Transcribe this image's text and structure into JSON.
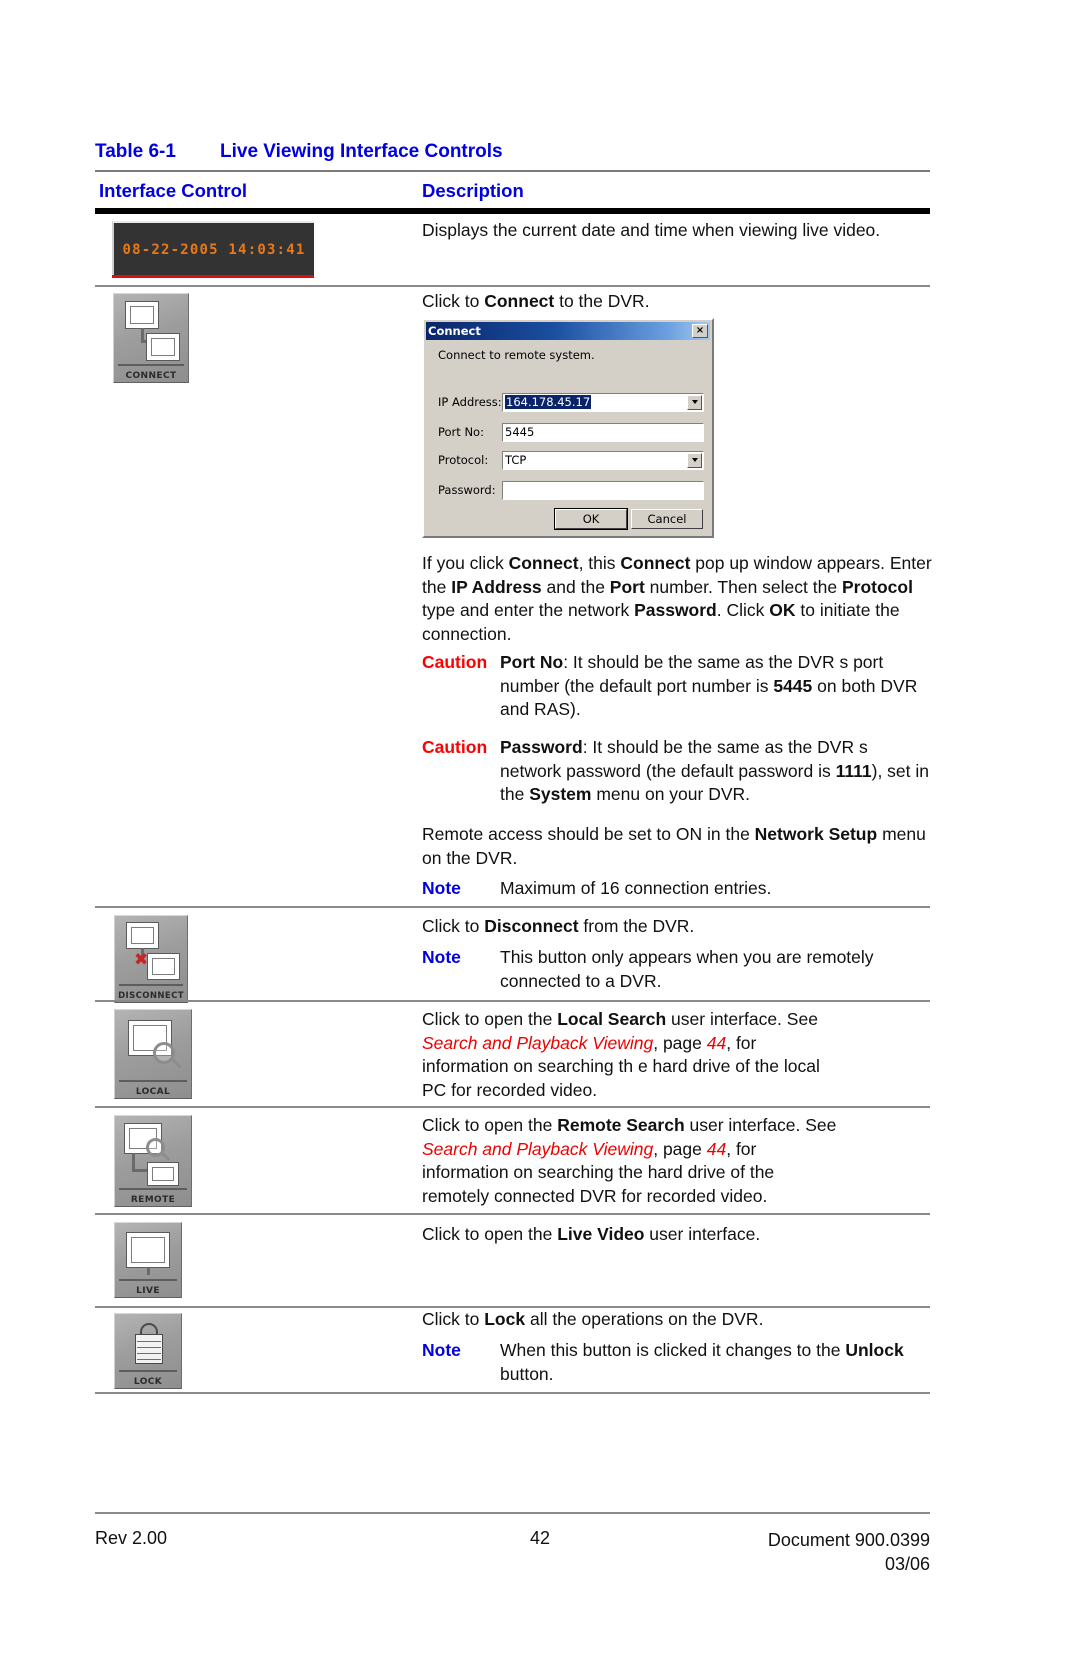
{
  "table": {
    "caption_label": "Table 6-1",
    "caption_title": "Live Viewing Interface Controls",
    "header_control": "Interface Control",
    "header_description": "Description"
  },
  "rows": {
    "datetime": {
      "display_value": "08-22-2005 14:03:41",
      "description": "Displays the current date and time when viewing live video."
    },
    "connect": {
      "icon_caption": "CONNECT",
      "lead_text_pre": "Click to ",
      "lead_text_bold": "Connect",
      "lead_text_post": " to the DVR.",
      "para1": "If you click Connect, this Connect pop up window appears. Enter the IP Address and the Port number. Then select the Protocol type and enter the network Password. Click OK to initiate the connection.",
      "caution1_label": "Caution",
      "caution1_text": "Port No: It should be the same as the DVR s port number (the default port number is  5445 on both DVR and RAS).",
      "caution2_label": "Caution",
      "caution2_text": "Password: It should be the same as the DVR s network password (the default password is 1111), set in the System menu on your DVR.",
      "para2": "Remote access should be set to ON in the Network Setup menu on the DVR.",
      "note_label": "Note",
      "note_text": "Maximum of 16 connection entries."
    },
    "disconnect": {
      "icon_caption": "DISCONNECT",
      "lead_pre": "Click to ",
      "lead_bold": "Disconnect",
      "lead_post": " from the DVR.",
      "note_label": "Note",
      "note_text": "This button only appears when you are remotely connected to a DVR."
    },
    "local": {
      "icon_caption": "LOCAL",
      "line1_pre": "Click to open the ",
      "line1_bold": "Local Search",
      "line1_post": " user interface. See",
      "ref_italic": "Search and Playback Viewing",
      "ref_mid": ", page ",
      "ref_page": "44",
      "ref_post": ", for",
      "line3": "information on searching th e hard drive of the local",
      "line4": "PC for recorded video."
    },
    "remote": {
      "icon_caption": "REMOTE",
      "line1_pre": "Click to open the ",
      "line1_bold": "Remote Search",
      "line1_post": " user interface. See",
      "ref_italic": "Search and Playback Viewing",
      "ref_mid": ", page ",
      "ref_page": "44",
      "ref_post": ", for",
      "line3": "information on searching  the hard drive of the",
      "line4": "remotely connected DVR for recorded video."
    },
    "live": {
      "icon_caption": "LIVE",
      "line1_pre": "Click to open the ",
      "line1_bold": "Live Video",
      "line1_post": " user interface."
    },
    "lock": {
      "icon_caption": "LOCK",
      "line1_pre": "Click to ",
      "line1_bold": "Lock",
      "line1_post": " all the operations on the DVR.",
      "note_label": "Note",
      "note_line1": "When this button is clicked it changes to the",
      "note_bold": "Unlock",
      "note_line2_post": " button."
    }
  },
  "dialog": {
    "title": "Connect",
    "close_glyph": "×",
    "subtitle": "Connect to remote system.",
    "fields": [
      {
        "label": "IP Address:",
        "value": "164.178.45.17",
        "has_dropdown": true,
        "selected": true
      },
      {
        "label": "Port No:",
        "value": "5445",
        "has_dropdown": false,
        "selected": false
      },
      {
        "label": "Protocol:",
        "value": "TCP",
        "has_dropdown": true,
        "selected": false
      },
      {
        "label": "Password:",
        "value": "",
        "has_dropdown": false,
        "selected": false
      }
    ],
    "ok_label": "OK",
    "cancel_label": "Cancel"
  },
  "footer": {
    "revision": "Rev 2.00",
    "page_number": "42",
    "document": "Document 900.0399",
    "date": "03/06"
  },
  "colors": {
    "heading_blue": "#0000E0",
    "note_blue": "#0000E0",
    "caution_red": "#FF0000",
    "reference_red": "#EE0000",
    "dvr_time_orange": "#E8791A"
  }
}
